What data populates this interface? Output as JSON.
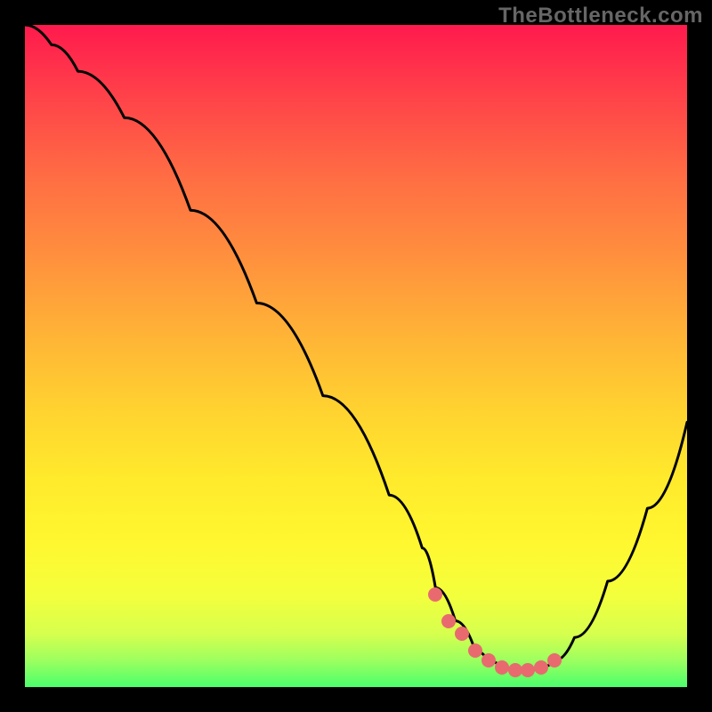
{
  "watermark": "TheBottleneck.com",
  "colors": {
    "background": "#000000",
    "gradient_top": "#ff1a4d",
    "gradient_bottom": "#4bff6c",
    "curve": "#000000",
    "marker": "#e86a6f"
  },
  "chart_data": {
    "type": "line",
    "title": "",
    "xlabel": "",
    "ylabel": "",
    "xlim": [
      0,
      100
    ],
    "ylim": [
      0,
      100
    ],
    "series": [
      {
        "name": "bottleneck-curve",
        "x": [
          0,
          4,
          8,
          15,
          25,
          35,
          45,
          55,
          60,
          62,
          65,
          68,
          70,
          72,
          74,
          76,
          78,
          80,
          83,
          88,
          94,
          100
        ],
        "values": [
          100,
          97,
          93,
          86,
          72,
          58,
          44,
          29,
          21,
          15,
          10,
          5.5,
          4.0,
          3.0,
          2.5,
          2.5,
          3.0,
          4.0,
          7.5,
          16,
          27,
          40
        ]
      }
    ],
    "markers": {
      "name": "valley-markers",
      "x": [
        62,
        64,
        66,
        68,
        70,
        72,
        74,
        76,
        78,
        80
      ],
      "values": [
        14,
        10,
        8,
        5.5,
        4.0,
        3.0,
        2.5,
        2.5,
        3.0,
        4.0
      ]
    },
    "annotations": []
  }
}
